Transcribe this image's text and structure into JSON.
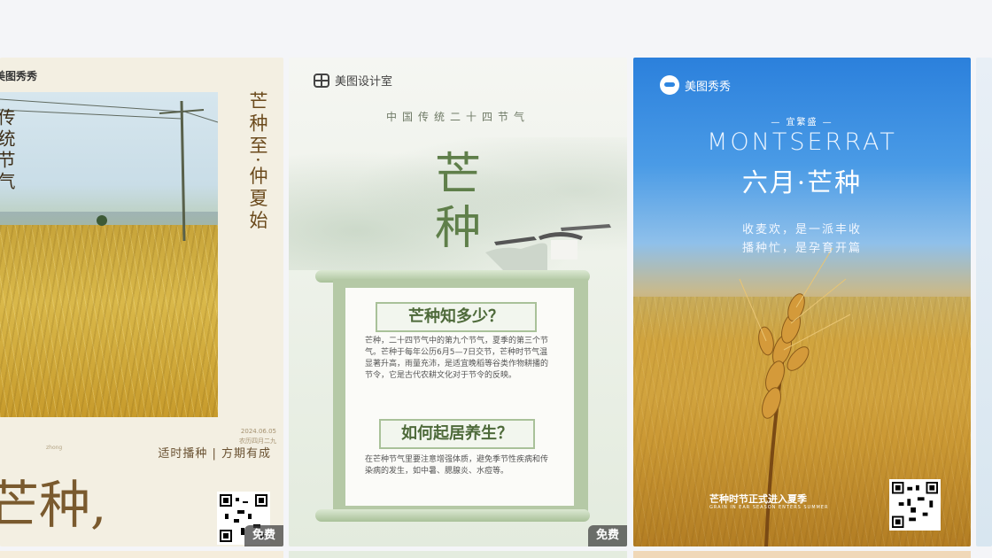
{
  "cards": [
    {
      "brand": "美图秀秀",
      "vertical_left": "传统节气",
      "vertical_right_1": "芒种至",
      "vertical_right_2": "·仲夏始",
      "date_line": "2024.06.05",
      "small_note": "农历四月二九",
      "tagline": "适时播种 | 方期有成",
      "big_title": "芒种,",
      "small_tag": "zhong",
      "badge": "免费"
    },
    {
      "brand": "美图设计室",
      "subtitle": "中国传统二十四节气",
      "title_1": "芒",
      "title_2": "种",
      "section1_title": "芒种知多少？",
      "section1_body": "芒种，二十四节气中的第九个节气，夏季的第三个节气。芒种于每年公历6月5—7日交节，芒种时节气温显著升高，雨量充沛，是适宜晚稻等谷类作物耕播的节令，它是古代农耕文化对于节令的反映。",
      "section2_title": "如何起居养生？",
      "section2_body": "在芒种节气里要注意增强体质，避免季节性疾病和传染病的发生，如中暑、腮腺炎、水痘等。",
      "badge": "免费"
    },
    {
      "brand": "美图秀秀",
      "yi": "— 宜繁盛 —",
      "latin": "MONTSERRAT",
      "title": "六月·芒种",
      "line1": "收麦欢，是一派丰收",
      "line2": "播种忙，是孕育开篇",
      "footer_cn": "芒种时节正式进入夏季",
      "footer_en": "GRAIN IN EAR SEASON ENTERS SUMMER"
    }
  ],
  "colors": {
    "card1_bg": "#f3efe2",
    "card1_text": "#7a5a2e",
    "card2_bg": "#eef2ea",
    "card2_green": "#5f7f4a",
    "card3_sky": "#2f86e0",
    "badge_bg": "#4a4a4a"
  }
}
